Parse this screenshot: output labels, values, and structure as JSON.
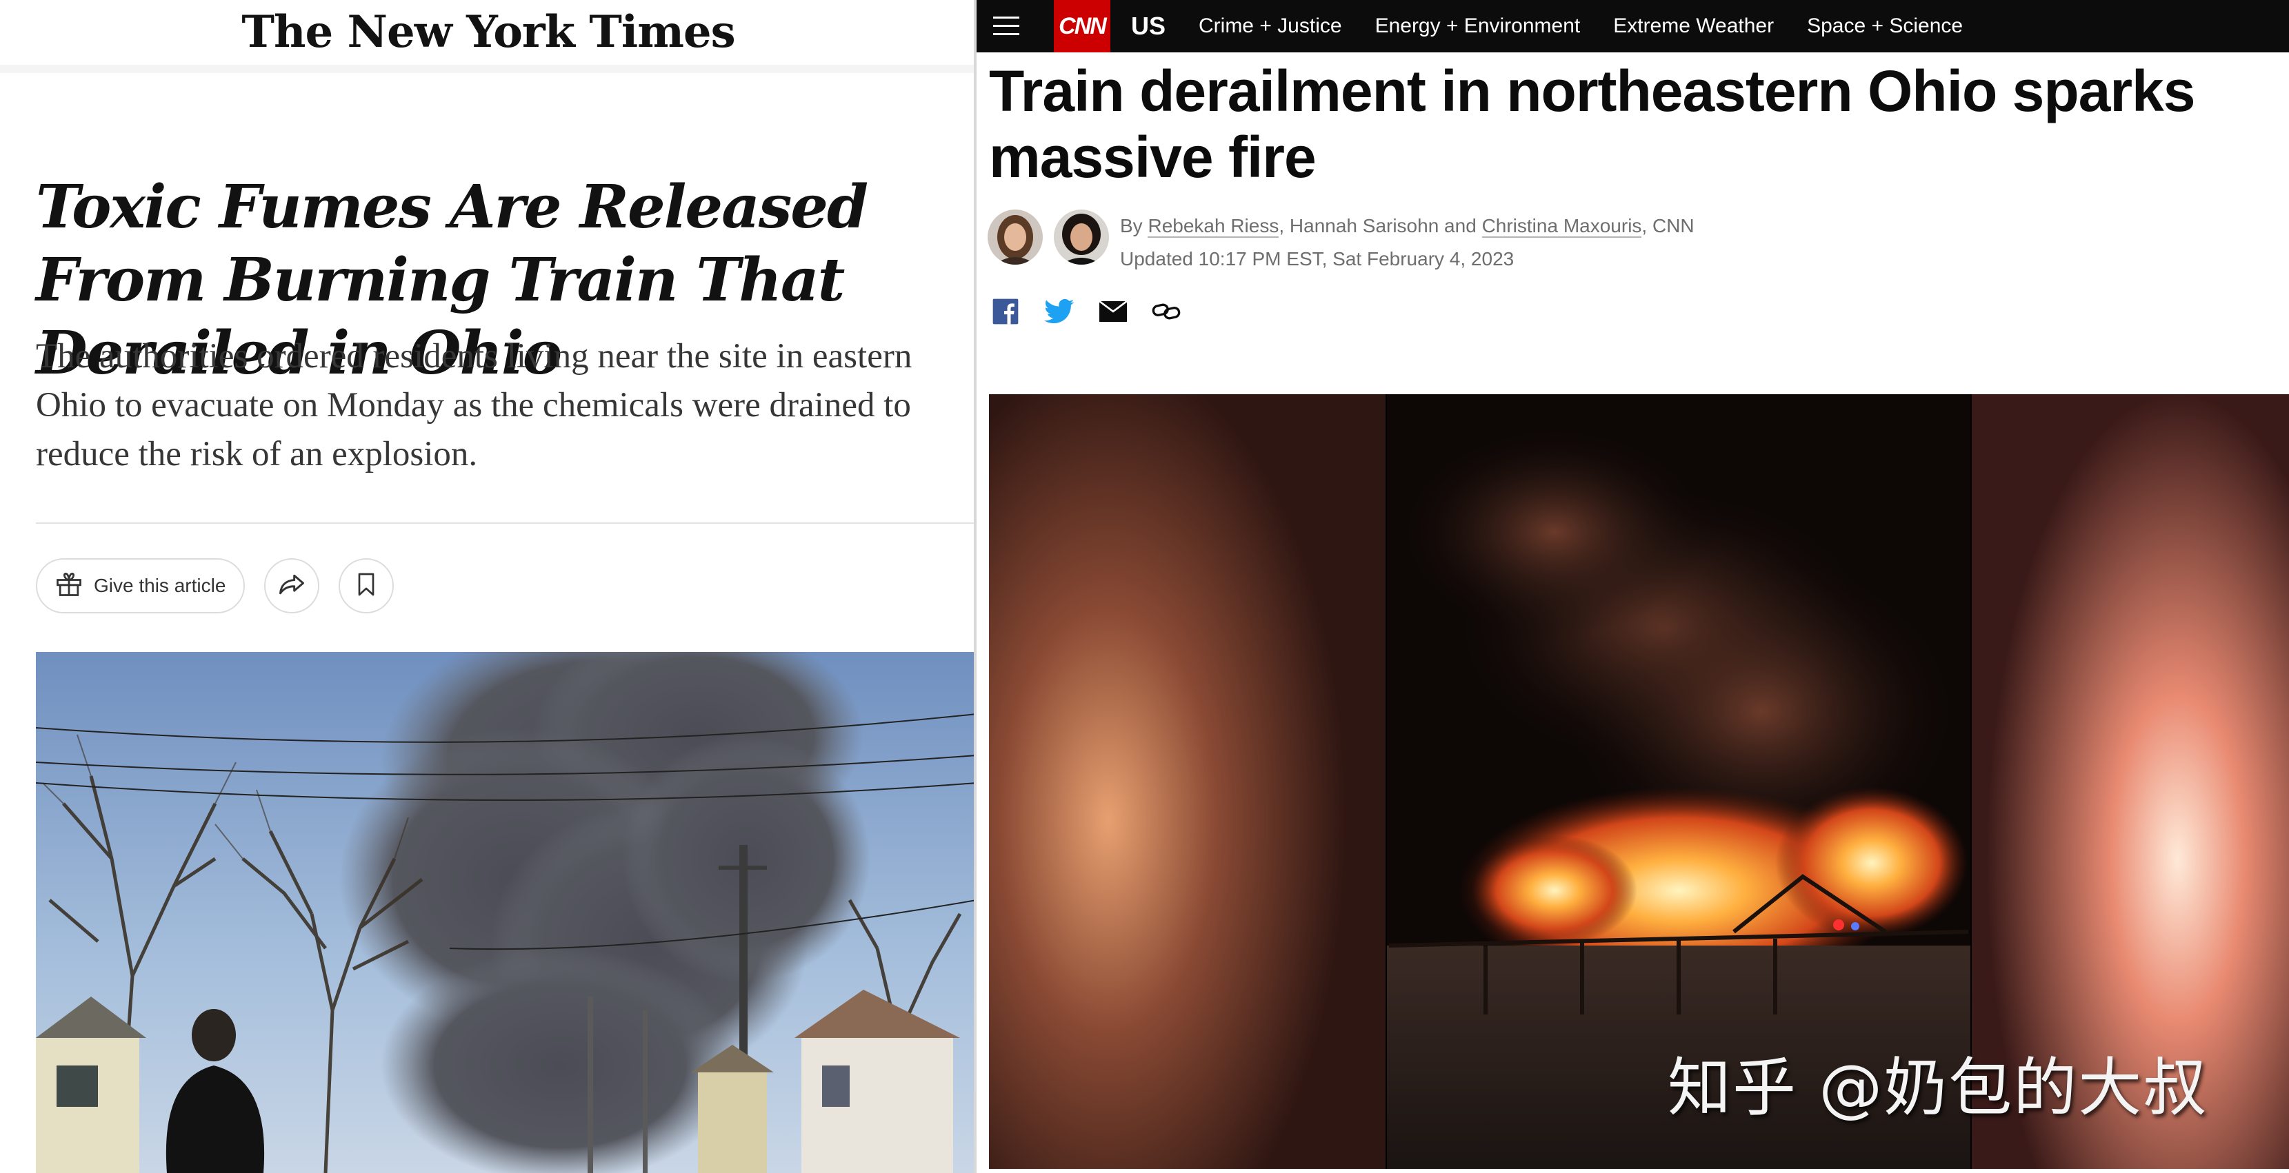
{
  "nyt": {
    "masthead": "The New York Times",
    "headline": "Toxic Fumes Are Released From Burning Train That Derailed in Ohio",
    "summary": "The authorities ordered residents living near the site in eastern Ohio to evacuate on Monday as the chemicals were drained to reduce the risk of an explosion.",
    "gift_label": "Give this article",
    "icons": [
      "gift-icon",
      "share-icon",
      "bookmark-icon"
    ],
    "photo_scene": "smoke-plume-over-street"
  },
  "cnn": {
    "logo": "CNN",
    "section": "US",
    "nav": [
      "Crime + Justice",
      "Energy + Environment",
      "Extreme Weather",
      "Space + Science"
    ],
    "headline": "Train derailment in northeastern Ohio sparks massive fire",
    "byline": {
      "prefix": "By ",
      "author1": "Rebekah Riess",
      "sep1": ", Hannah Sarisohn and ",
      "author3": "Christina Maxouris",
      "suffix": ", CNN"
    },
    "updated": "Updated 10:17 PM EST, Sat February 4, 2023",
    "share_icons": [
      "facebook-icon",
      "twitter-icon",
      "email-icon",
      "link-icon"
    ],
    "photo_scene": "night-train-fire",
    "colors": {
      "brand_red": "#cc0000",
      "nav_bg": "#0c0c0c",
      "facebook": "#3b5998",
      "twitter": "#1da1f2"
    }
  },
  "watermark": "知乎 @奶包的大叔"
}
